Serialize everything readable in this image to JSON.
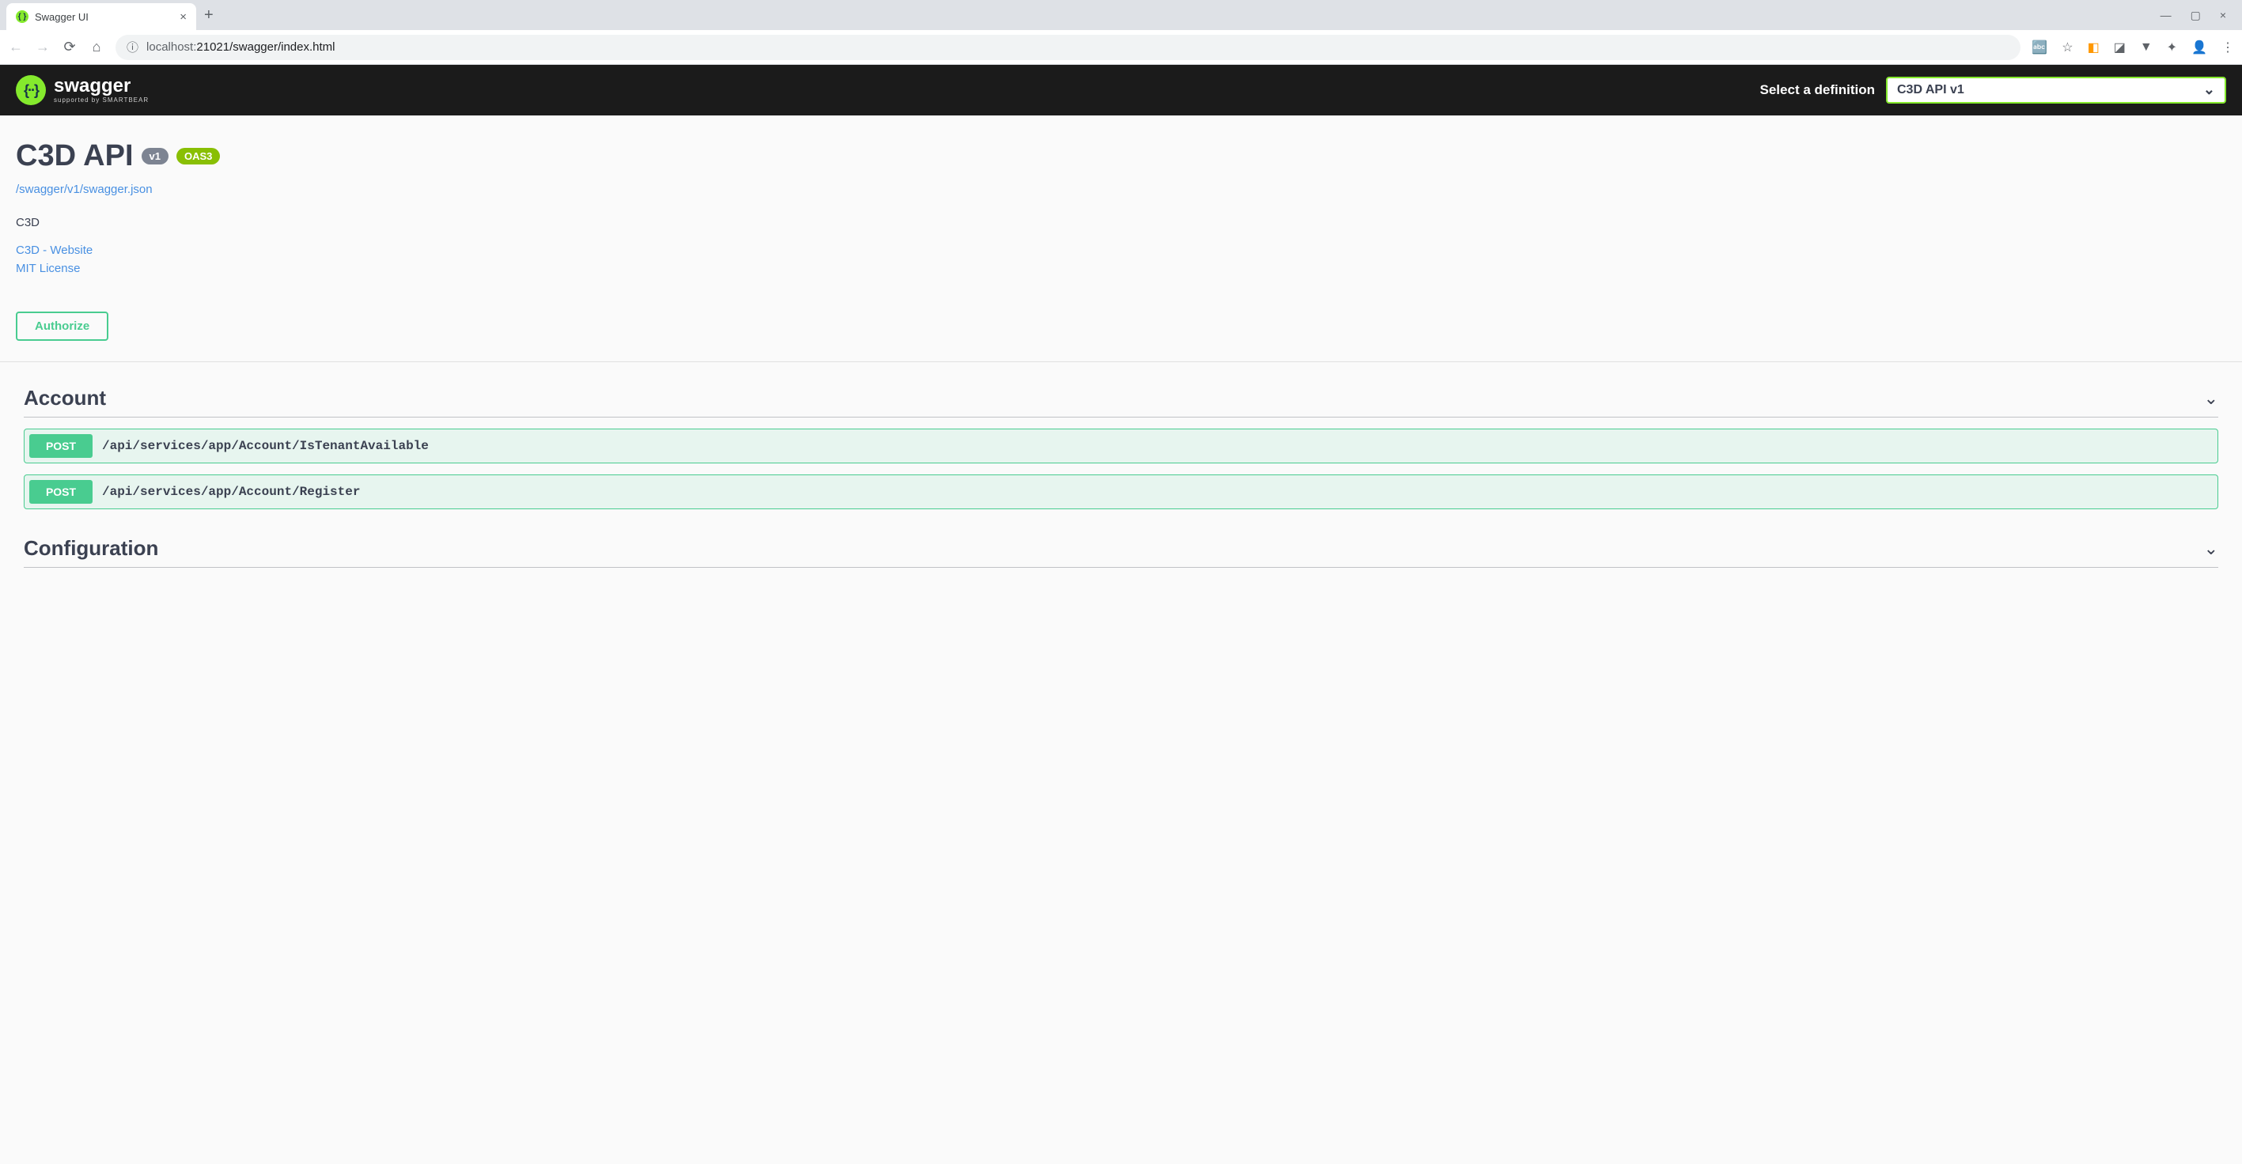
{
  "browser": {
    "tab_title": "Swagger UI",
    "url_host": "localhost:",
    "url_port_path": "21021/swagger/index.html"
  },
  "topbar": {
    "logo_main": "swagger",
    "logo_sub": "supported by SMARTBEAR",
    "def_label": "Select a definition",
    "def_selected": "C3D API v1"
  },
  "info": {
    "title": "C3D API",
    "version_badge": "v1",
    "oas_badge": "OAS3",
    "spec_url": "/swagger/v1/swagger.json",
    "description": "C3D",
    "website_link": "C3D - Website",
    "license_link": "MIT License"
  },
  "authorize": {
    "label": "Authorize"
  },
  "tags": [
    {
      "name": "Account",
      "ops": [
        {
          "method": "POST",
          "path": "/api/services/app/Account/IsTenantAvailable"
        },
        {
          "method": "POST",
          "path": "/api/services/app/Account/Register"
        }
      ]
    },
    {
      "name": "Configuration",
      "ops": []
    }
  ]
}
